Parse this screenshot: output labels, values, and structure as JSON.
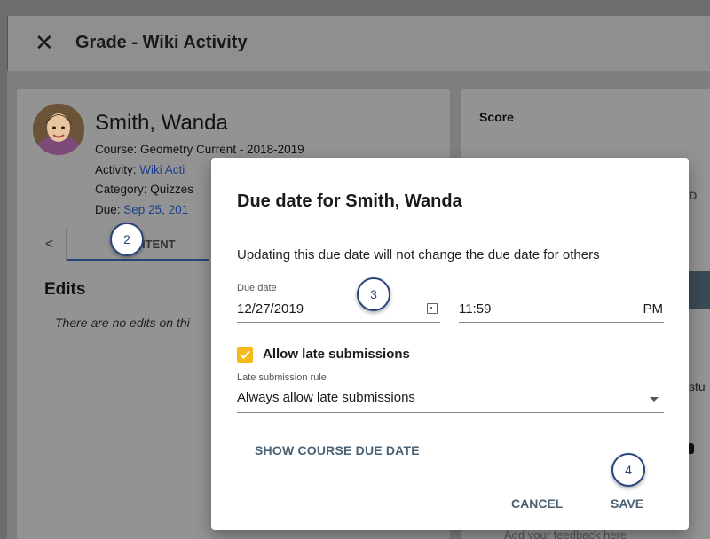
{
  "header": {
    "close_icon": "close-icon",
    "title": "Grade - Wiki Activity"
  },
  "student": {
    "name": "Smith, Wanda",
    "course_prefix": "Course: ",
    "course": "Geometry Current - 2018-2019",
    "activity_prefix": "Activity: ",
    "activity": "Wiki Acti",
    "category_prefix": "Category: ",
    "category": "Quizzes",
    "due_prefix": "Due: ",
    "due": "Sep 25, 201"
  },
  "tabs": {
    "prev_label": "<",
    "current_label": "ITENT"
  },
  "edits": {
    "heading": "Edits",
    "empty_text": "There are no edits on thi"
  },
  "score_panel": {
    "label": "Score",
    "fragment_red": "RED",
    "fragment_stu": "stu",
    "feedback_placeholder": "Add your feedback here"
  },
  "dialog": {
    "title": "Due date for Smith, Wanda",
    "description": "Updating this due date will not change the due date for others",
    "due_date_label": "Due date",
    "date_value": "12/27/2019",
    "time_value": "11:59",
    "ampm": "PM",
    "allow_late_label": "Allow late submissions",
    "allow_late_checked": true,
    "late_rule_label": "Late submission rule",
    "late_rule_value": "Always allow late submissions",
    "show_course_due_label": "SHOW COURSE DUE DATE",
    "cancel_label": "CANCEL",
    "save_label": "SAVE"
  },
  "steps": {
    "two": "2",
    "three": "3",
    "four": "4"
  },
  "colors": {
    "accent": "#f5b91b",
    "button_text": "#4a6274",
    "step_ring": "#27457a",
    "overlay": "#7e7e7e"
  }
}
